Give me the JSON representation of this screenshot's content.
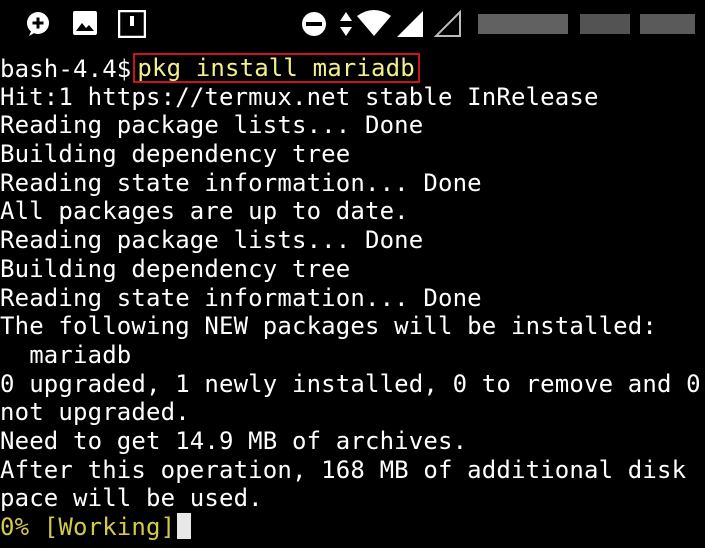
{
  "status_bar": {
    "icons": [
      "whatsapp-icon",
      "gallery-icon",
      "flipboard-icon",
      "dnd-icon",
      "data-transfer-icon",
      "wifi-icon",
      "signal-icon",
      "signal-empty-icon"
    ]
  },
  "terminal": {
    "prompt": "bash-4.4$",
    "command": "pkg install mariadb",
    "output": [
      "Hit:1 https://termux.net stable InRelease",
      "Reading package lists... Done",
      "Building dependency tree",
      "Reading state information... Done",
      "All packages are up to date.",
      "Reading package lists... Done",
      "Building dependency tree",
      "Reading state information... Done",
      "The following NEW packages will be installed:",
      "  mariadb",
      "0 upgraded, 1 newly installed, 0 to remove and 0",
      "not upgraded.",
      "Need to get 14.9 MB of archives.",
      "After this operation, 168 MB of additional disk",
      "pace will be used."
    ],
    "progress": "0% [Working]"
  },
  "colors": {
    "background": "#000000",
    "text": "#ffffff",
    "command": "#f4ef8a",
    "highlight_border": "#c8141a",
    "progress": "#d3c94a"
  }
}
